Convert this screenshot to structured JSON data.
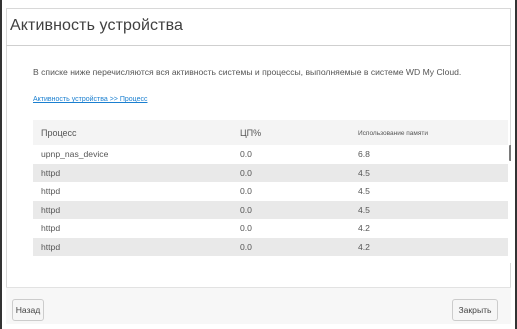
{
  "dialog": {
    "title": "Активность устройства",
    "description": "В списке ниже перечисляются вся активность системы и процессы, выполняемые в системе WD My Cloud.",
    "breadcrumb": "Активность устройства >> Процесс"
  },
  "table": {
    "headers": {
      "process": "Процесс",
      "cpu": "ЦП%",
      "memory": "Использование памяти"
    },
    "rows": [
      {
        "process": "upnp_nas_device",
        "cpu": "0.0",
        "memory": "6.8"
      },
      {
        "process": "httpd",
        "cpu": "0.0",
        "memory": "4.5"
      },
      {
        "process": "httpd",
        "cpu": "0.0",
        "memory": "4.5"
      },
      {
        "process": "httpd",
        "cpu": "0.0",
        "memory": "4.5"
      },
      {
        "process": "httpd",
        "cpu": "0.0",
        "memory": "4.2"
      },
      {
        "process": "httpd",
        "cpu": "0.0",
        "memory": "4.2"
      }
    ]
  },
  "footer": {
    "back_label": "Назад",
    "close_label": "Закрыть"
  }
}
